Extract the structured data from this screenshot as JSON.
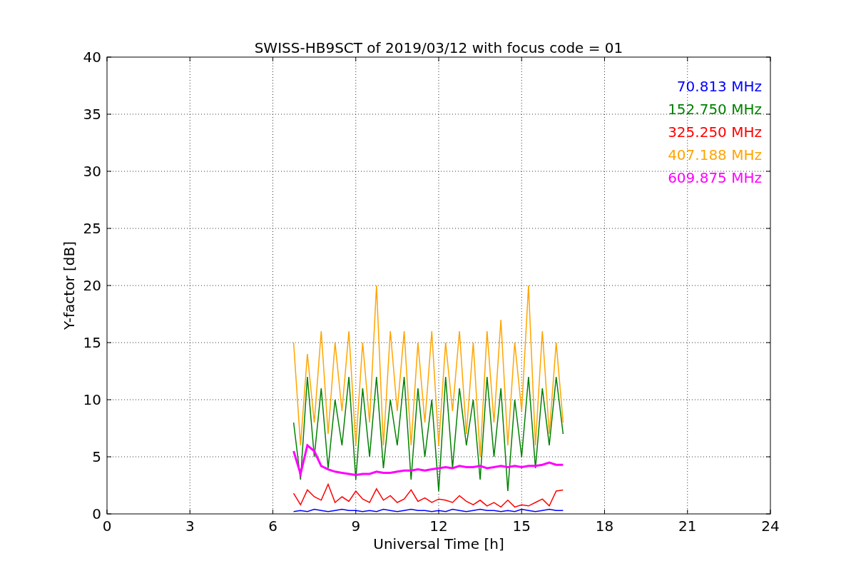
{
  "chart_data": {
    "type": "line",
    "grid": true,
    "title": "SWISS-HB9SCT of 2019/03/12 with focus code = 01",
    "xlabel": "Universal Time [h]",
    "ylabel": "Y-factor [dB]",
    "xlim": [
      0,
      24
    ],
    "ylim": [
      0,
      40
    ],
    "xticks": [
      0,
      3,
      6,
      9,
      12,
      15,
      18,
      21,
      24
    ],
    "yticks": [
      0,
      5,
      10,
      15,
      20,
      25,
      30,
      35,
      40
    ],
    "x": [
      6.75,
      7,
      7.25,
      7.5,
      7.75,
      8,
      8.25,
      8.5,
      8.75,
      9,
      9.25,
      9.5,
      9.75,
      10,
      10.25,
      10.5,
      10.75,
      11,
      11.25,
      11.5,
      11.75,
      12,
      12.25,
      12.5,
      12.75,
      13,
      13.25,
      13.5,
      13.75,
      14,
      14.25,
      14.5,
      14.75,
      15,
      15.25,
      15.5,
      15.75,
      16,
      16.25,
      16.5
    ],
    "series": [
      {
        "name": "70.813 MHz",
        "color": "#0000ff",
        "values": [
          0.2,
          0.3,
          0.2,
          0.4,
          0.3,
          0.2,
          0.3,
          0.4,
          0.3,
          0.3,
          0.2,
          0.3,
          0.2,
          0.4,
          0.3,
          0.2,
          0.3,
          0.4,
          0.3,
          0.3,
          0.2,
          0.3,
          0.2,
          0.4,
          0.3,
          0.2,
          0.3,
          0.4,
          0.3,
          0.3,
          0.2,
          0.3,
          0.2,
          0.4,
          0.3,
          0.2,
          0.3,
          0.4,
          0.3,
          0.3
        ]
      },
      {
        "name": "152.750 MHz",
        "color": "#008000",
        "values": [
          8,
          3,
          12,
          5,
          11,
          4,
          10,
          6,
          12,
          3,
          11,
          5,
          12,
          4,
          10,
          6,
          12,
          3,
          11,
          5,
          10,
          2,
          12,
          4,
          11,
          6,
          10,
          3,
          12,
          5,
          11,
          2,
          10,
          5,
          12,
          4,
          11,
          6,
          12,
          7
        ]
      },
      {
        "name": "325.250 MHz",
        "color": "#ff0000",
        "values": [
          1.8,
          0.8,
          2.1,
          1.5,
          1.2,
          2.6,
          1.0,
          1.5,
          1.1,
          2.0,
          1.3,
          1.0,
          2.2,
          1.2,
          1.6,
          1.0,
          1.3,
          2.1,
          1.1,
          1.4,
          1.0,
          1.3,
          1.2,
          1.0,
          1.6,
          1.1,
          0.8,
          1.2,
          0.7,
          1.0,
          0.6,
          1.2,
          0.6,
          0.8,
          0.7,
          1.0,
          1.3,
          0.7,
          2.0,
          2.1
        ]
      },
      {
        "name": "407.188 MHz",
        "color": "#ffa500",
        "values": [
          15,
          6,
          14,
          8,
          16,
          7,
          15,
          9,
          16,
          6,
          15,
          8,
          20,
          6,
          16,
          9,
          16,
          6,
          15,
          8,
          16,
          6,
          15,
          9,
          16,
          7,
          15,
          5,
          16,
          8,
          17,
          6,
          15,
          9,
          20,
          6,
          16,
          7,
          15,
          8
        ]
      },
      {
        "name": "609.875 MHz",
        "color": "#ff00ff",
        "values": [
          5.5,
          3.5,
          6.0,
          5.5,
          4.2,
          3.9,
          3.7,
          3.6,
          3.5,
          3.4,
          3.5,
          3.5,
          3.7,
          3.6,
          3.6,
          3.7,
          3.8,
          3.8,
          3.9,
          3.8,
          3.9,
          4.0,
          4.1,
          4.0,
          4.2,
          4.1,
          4.1,
          4.2,
          4.0,
          4.1,
          4.2,
          4.1,
          4.2,
          4.1,
          4.2,
          4.2,
          4.3,
          4.5,
          4.3,
          4.3
        ]
      }
    ]
  }
}
